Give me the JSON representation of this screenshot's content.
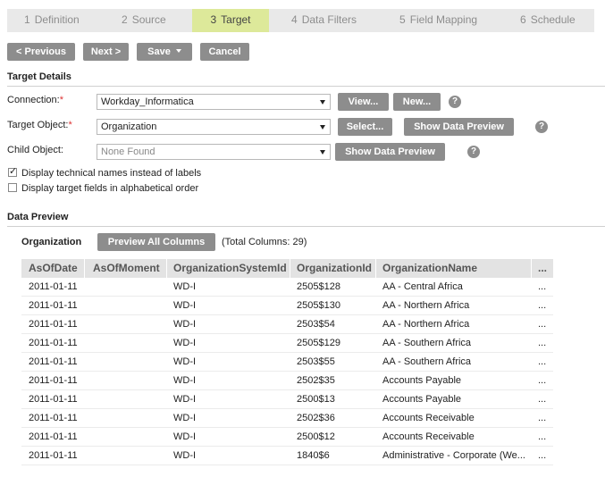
{
  "wizard": {
    "steps": [
      {
        "num": "1",
        "label": "Definition"
      },
      {
        "num": "2",
        "label": "Source"
      },
      {
        "num": "3",
        "label": "Target"
      },
      {
        "num": "4",
        "label": "Data Filters"
      },
      {
        "num": "5",
        "label": "Field Mapping"
      },
      {
        "num": "6",
        "label": "Schedule"
      }
    ],
    "active_step": "3"
  },
  "toolbar": {
    "previous_label": "< Previous",
    "next_label": "Next >",
    "save_label": "Save",
    "cancel_label": "Cancel"
  },
  "target_details": {
    "title": "Target Details",
    "connection": {
      "label": "Connection:",
      "required": "*",
      "value": "Workday_Informatica",
      "view_label": "View...",
      "new_label": "New..."
    },
    "target_object": {
      "label": "Target Object:",
      "required": "*",
      "value": "Organization",
      "select_label": "Select...",
      "preview_label": "Show Data Preview"
    },
    "child_object": {
      "label": "Child Object:",
      "value": "None Found",
      "preview_label": "Show Data Preview"
    },
    "help_glyph": "?",
    "options": [
      {
        "label": "Display technical names instead of labels",
        "checked": true
      },
      {
        "label": "Display target fields in alphabetical order",
        "checked": false
      }
    ]
  },
  "data_preview": {
    "title": "Data Preview",
    "object_name": "Organization",
    "preview_all_label": "Preview All Columns",
    "total_columns": "(Total Columns: 29)",
    "columns": [
      "AsOfDate",
      "AsOfMoment",
      "OrganizationSystemId",
      "OrganizationId",
      "OrganizationName",
      "..."
    ],
    "rows": [
      [
        "2011-01-11",
        "",
        "WD-I",
        "2505$128",
        "AA - Central Africa",
        "..."
      ],
      [
        "2011-01-11",
        "",
        "WD-I",
        "2505$130",
        "AA - Northern Africa",
        "..."
      ],
      [
        "2011-01-11",
        "",
        "WD-I",
        "2503$54",
        "AA - Northern Africa",
        "..."
      ],
      [
        "2011-01-11",
        "",
        "WD-I",
        "2505$129",
        "AA - Southern Africa",
        "..."
      ],
      [
        "2011-01-11",
        "",
        "WD-I",
        "2503$55",
        "AA - Southern Africa",
        "..."
      ],
      [
        "2011-01-11",
        "",
        "WD-I",
        "2502$35",
        "Accounts Payable",
        "..."
      ],
      [
        "2011-01-11",
        "",
        "WD-I",
        "2500$13",
        "Accounts Payable",
        "..."
      ],
      [
        "2011-01-11",
        "",
        "WD-I",
        "2502$36",
        "Accounts Receivable",
        "..."
      ],
      [
        "2011-01-11",
        "",
        "WD-I",
        "2500$12",
        "Accounts Receivable",
        "..."
      ],
      [
        "2011-01-11",
        "",
        "WD-I",
        "1840$6",
        "Administrative - Corporate (We...",
        "..."
      ]
    ]
  }
}
